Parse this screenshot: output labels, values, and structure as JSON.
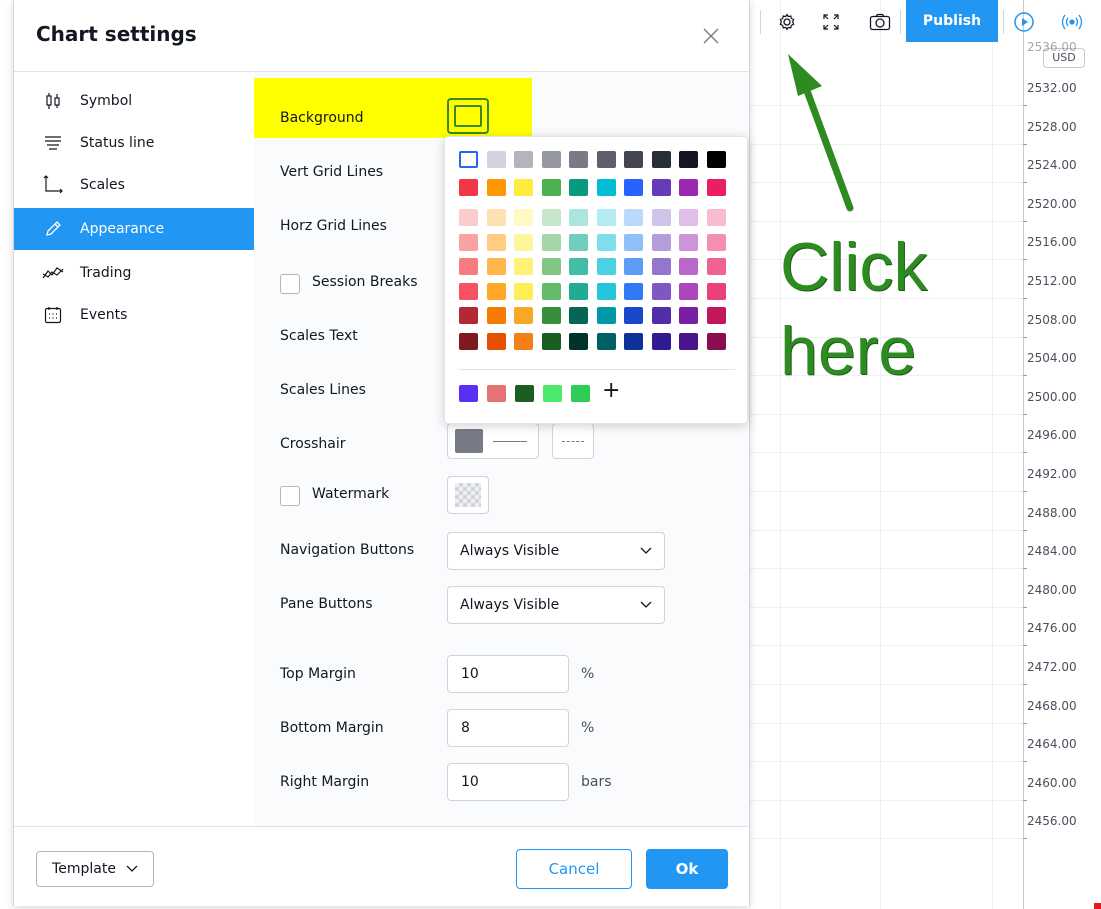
{
  "dialog": {
    "title": "Chart settings",
    "close_label": "×"
  },
  "sidebar": {
    "items": [
      {
        "label": "Symbol",
        "icon": "candles-icon",
        "active": false
      },
      {
        "label": "Status line",
        "icon": "lines-icon",
        "active": false
      },
      {
        "label": "Scales",
        "icon": "scales-icon",
        "active": false
      },
      {
        "label": "Appearance",
        "icon": "pencil-icon",
        "active": true
      },
      {
        "label": "Trading",
        "icon": "trading-icon",
        "active": false
      },
      {
        "label": "Events",
        "icon": "calendar-icon",
        "active": false
      }
    ]
  },
  "appearance": {
    "background_label": "Background",
    "vert_grid_label": "Vert Grid Lines",
    "horz_grid_label": "Horz Grid Lines",
    "session_breaks_label": "Session Breaks",
    "scales_text_label": "Scales Text",
    "scales_lines_label": "Scales Lines",
    "crosshair_label": "Crosshair",
    "watermark_label": "Watermark",
    "nav_buttons_label": "Navigation Buttons",
    "nav_buttons_value": "Always Visible",
    "pane_buttons_label": "Pane Buttons",
    "pane_buttons_value": "Always Visible",
    "top_margin_label": "Top Margin",
    "top_margin_value": "10",
    "top_margin_unit": "%",
    "bottom_margin_label": "Bottom Margin",
    "bottom_margin_value": "8",
    "bottom_margin_unit": "%",
    "right_margin_label": "Right Margin",
    "right_margin_value": "10",
    "right_margin_unit": "bars",
    "session_breaks_checked": false,
    "watermark_checked": false,
    "crosshair_color": "#787b86",
    "background_highlight": "#ffff00"
  },
  "color_picker": {
    "rows": [
      [
        "#ffffff",
        "#d1d4dc",
        "#b2b5be",
        "#9598a1",
        "#787b86",
        "#5d606b",
        "#434651",
        "#2a2e39",
        "#131722",
        "#000000"
      ],
      [
        "#f23645",
        "#ff9800",
        "#ffeb3b",
        "#4caf50",
        "#089981",
        "#00bcd4",
        "#2962ff",
        "#673ab7",
        "#9c27b0",
        "#e91e63"
      ],
      [
        "#fccbcd",
        "#ffe0b2",
        "#fff9c4",
        "#c8e6c9",
        "#ace5dc",
        "#b2ebf2",
        "#bbd9fb",
        "#d1c4e9",
        "#e1bee7",
        "#f8bbd0"
      ],
      [
        "#faa1a4",
        "#ffcc80",
        "#fff59d",
        "#a5d6a7",
        "#70ccbd",
        "#80deea",
        "#90bff9",
        "#b39ddb",
        "#ce93d8",
        "#f48fb1"
      ],
      [
        "#f77c80",
        "#ffb74d",
        "#fff176",
        "#81c784",
        "#42bda8",
        "#4dd0e1",
        "#5b9cf6",
        "#9575cd",
        "#ba68c8",
        "#f06292"
      ],
      [
        "#f7525f",
        "#ffa726",
        "#ffee58",
        "#66bb6a",
        "#22ab94",
        "#26c6da",
        "#3179f5",
        "#7e57c2",
        "#ab47bc",
        "#ec407a"
      ],
      [
        "#b22833",
        "#f57c00",
        "#f9a825",
        "#388e3c",
        "#056656",
        "#0097a7",
        "#1848cc",
        "#512da8",
        "#7b1fa2",
        "#c2185b"
      ],
      [
        "#801922",
        "#e65100",
        "#f57f17",
        "#1b5e20",
        "#00332a",
        "#006064",
        "#0c3299",
        "#311b92",
        "#4a148c",
        "#880e4f"
      ]
    ],
    "custom": [
      "#5b2ef5",
      "#e57373",
      "#1b5e20",
      "#4ee86a",
      "#2ecc55"
    ],
    "add_label": "+"
  },
  "footer": {
    "template_label": "Template",
    "cancel_label": "Cancel",
    "ok_label": "Ok"
  },
  "toolbar": {
    "publish_label": "Publish",
    "settings_icon": "gear-icon",
    "fullscreen_icon": "fullscreen-icon",
    "snapshot_icon": "camera-icon",
    "replay_icon": "play-icon",
    "broadcast_icon": "broadcast-icon"
  },
  "price_axis": {
    "currency": "USD",
    "top_value": "2536.00",
    "labels": [
      "2532.00",
      "2528.00",
      "2524.00",
      "2520.00",
      "2516.00",
      "2512.00",
      "2508.00",
      "2504.00",
      "2500.00",
      "2496.00",
      "2492.00",
      "2488.00",
      "2484.00",
      "2480.00",
      "2476.00",
      "2472.00",
      "2468.00",
      "2464.00",
      "2460.00",
      "2456.00"
    ]
  },
  "annotation": {
    "line1": "Click",
    "line2": "here",
    "color": "#2e8b22"
  }
}
